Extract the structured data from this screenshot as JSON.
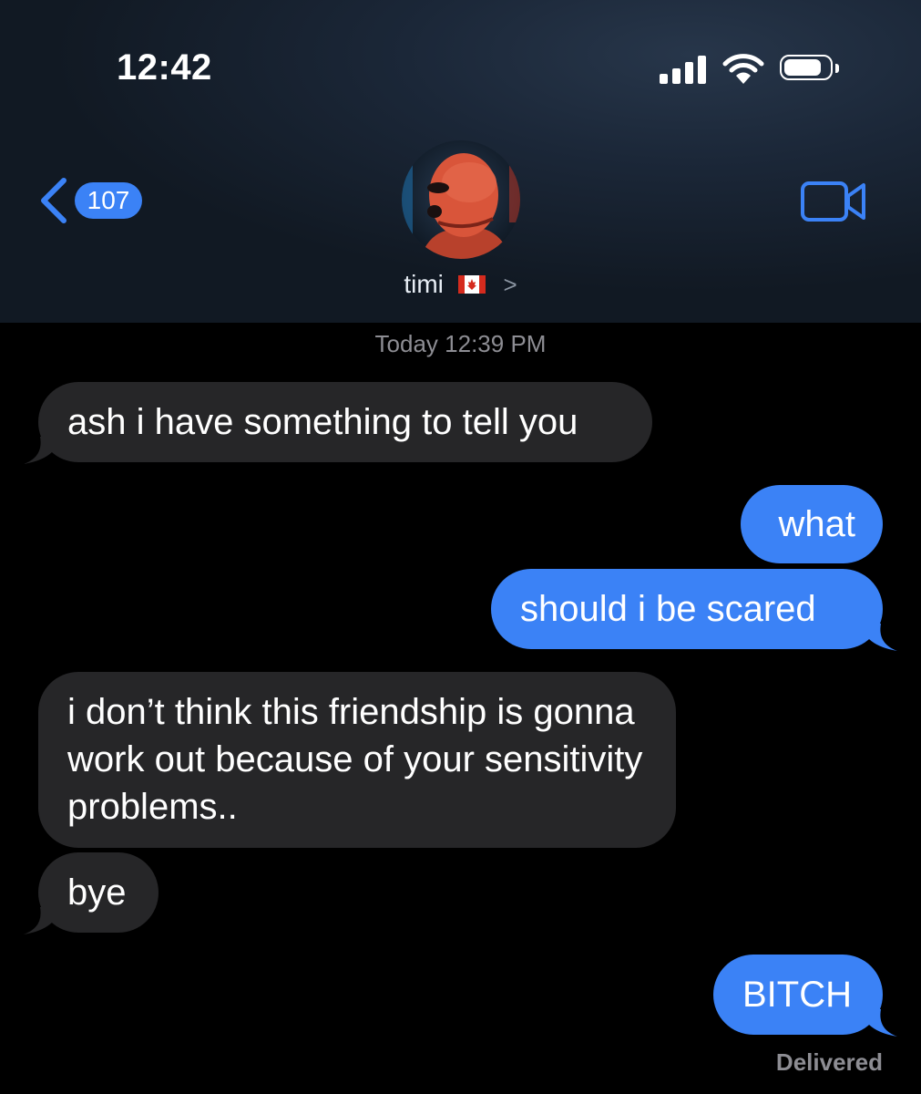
{
  "status_bar": {
    "time": "12:42"
  },
  "nav": {
    "back_count": "107"
  },
  "contact": {
    "name": "timi",
    "flag": "🇨🇦",
    "chevron": ">"
  },
  "conversation": {
    "timestamp": "Today 12:39 PM",
    "messages": [
      {
        "direction": "received",
        "text": "ash i have something to tell you"
      },
      {
        "direction": "sent",
        "text": "what"
      },
      {
        "direction": "sent",
        "text": "should i be scared"
      },
      {
        "direction": "received",
        "text": "i don’t think this friendship is gonna work out because of your sensitivity problems.."
      },
      {
        "direction": "received",
        "text": "bye"
      },
      {
        "direction": "sent",
        "text": "BITCH"
      }
    ],
    "status": "Delivered"
  },
  "colors": {
    "sent_bubble": "#3b82f6",
    "received_bubble": "#262628",
    "background": "#000000",
    "accent": "#3b82f6"
  }
}
